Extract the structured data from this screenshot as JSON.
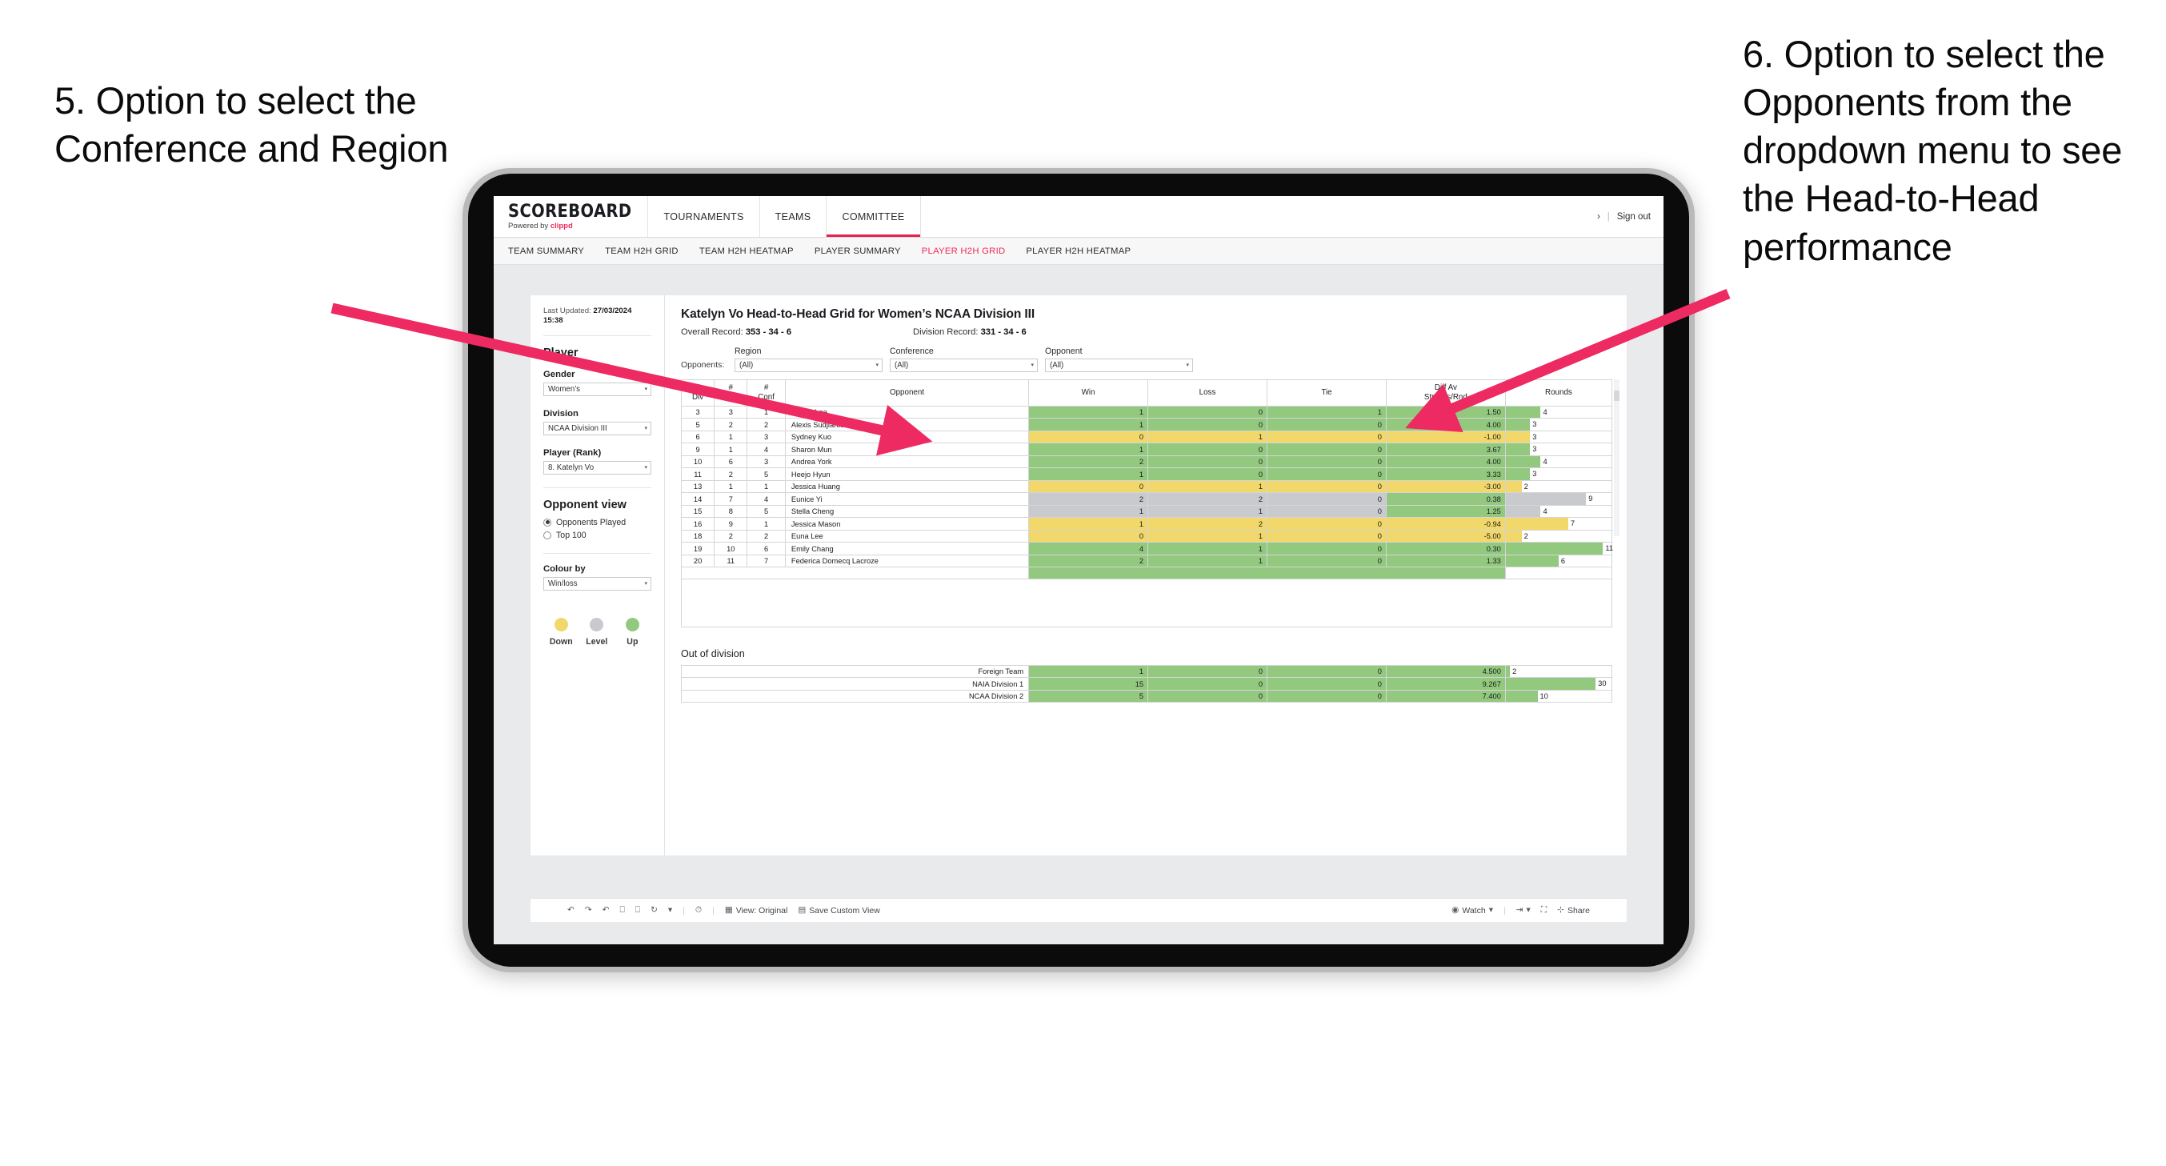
{
  "annotations": {
    "left": "5. Option to select the Conference and Region",
    "right": "6. Option to select the Opponents from the dropdown menu to see the Head-to-Head performance"
  },
  "colors": {
    "accent": "#ee2060",
    "arrow": "#ee2a62",
    "up_green": "#93c97e",
    "down_yellow": "#f2d86a",
    "level_gray": "#c9cace"
  },
  "topnav": {
    "brand_name": "SCOREBOARD",
    "brand_sub_prefix": "Powered by ",
    "brand_sub_accent": "clippd",
    "items": [
      {
        "label": "TOURNAMENTS",
        "active": false
      },
      {
        "label": "TEAMS",
        "active": false
      },
      {
        "label": "COMMITTEE",
        "active": true
      }
    ],
    "chevron": "›",
    "divider": "|",
    "signout": "Sign out"
  },
  "subnav": {
    "items": [
      {
        "label": "TEAM SUMMARY",
        "active": false
      },
      {
        "label": "TEAM H2H GRID",
        "active": false
      },
      {
        "label": "TEAM H2H HEATMAP",
        "active": false
      },
      {
        "label": "PLAYER SUMMARY",
        "active": false
      },
      {
        "label": "PLAYER H2H GRID",
        "active": true
      },
      {
        "label": "PLAYER H2H HEATMAP",
        "active": false
      }
    ]
  },
  "sidebar": {
    "last_updated_label": "Last Updated: ",
    "last_updated_value": "27/03/2024 15:38",
    "player_heading": "Player",
    "gender": {
      "label": "Gender",
      "value": "Women’s"
    },
    "division": {
      "label": "Division",
      "value": "NCAA Division III"
    },
    "player_rank": {
      "label": "Player (Rank)",
      "value": "8. Katelyn Vo"
    },
    "opponent_view": {
      "heading": "Opponent view",
      "options": [
        {
          "label": "Opponents Played",
          "selected": true
        },
        {
          "label": "Top 100",
          "selected": false
        }
      ]
    },
    "colour_by": {
      "label": "Colour by",
      "value": "Win/loss"
    },
    "legend": [
      {
        "label": "Down",
        "color": "#f2d86a"
      },
      {
        "label": "Level",
        "color": "#c9cace"
      },
      {
        "label": "Up",
        "color": "#93c97e"
      }
    ]
  },
  "main": {
    "title": "Katelyn Vo Head-to-Head Grid for Women’s NCAA Division III",
    "overall_record_label": "Overall Record: ",
    "overall_record_value": "353 - 34 - 6",
    "division_record_label": "Division Record: ",
    "division_record_value": "331 - 34 - 6",
    "opponents_label": "Opponents:",
    "filters": [
      {
        "label": "Region",
        "value": "(All)"
      },
      {
        "label": "Conference",
        "value": "(All)"
      },
      {
        "label": "Opponent",
        "value": "(All)"
      }
    ]
  },
  "chart_data": {
    "type": "table",
    "title": "Katelyn Vo Head-to-Head Grid for Women’s NCAA Division III",
    "columns": [
      "# Div",
      "# Reg",
      "# Conf",
      "Opponent",
      "Win",
      "Loss",
      "Tie",
      "Diff Av Strokes/Rnd",
      "Rounds"
    ],
    "column_headers_two_line": [
      [
        "#",
        "Div"
      ],
      [
        "#",
        "Reg"
      ],
      [
        "#",
        "Conf"
      ],
      [
        "Opponent",
        ""
      ],
      [
        "Win",
        ""
      ],
      [
        "Loss",
        ""
      ],
      [
        "Tie",
        ""
      ],
      [
        "Diff Av",
        "Strokes/Rnd"
      ],
      [
        "Rounds",
        ""
      ]
    ],
    "rows": [
      {
        "div": "3",
        "reg": "3",
        "conf": "1",
        "opponent": "Esther Lee",
        "win": "1",
        "loss": "0",
        "tie": "1",
        "diff": "1.50",
        "rounds": "4",
        "rounds_pct": 33,
        "state": "up"
      },
      {
        "div": "5",
        "reg": "2",
        "conf": "2",
        "opponent": "Alexis Sudjianto",
        "win": "1",
        "loss": "0",
        "tie": "0",
        "diff": "4.00",
        "rounds": "3",
        "rounds_pct": 23,
        "state": "up"
      },
      {
        "div": "6",
        "reg": "1",
        "conf": "3",
        "opponent": "Sydney Kuo",
        "win": "0",
        "loss": "1",
        "tie": "0",
        "diff": "-1.00",
        "rounds": "3",
        "rounds_pct": 23,
        "state": "down"
      },
      {
        "div": "9",
        "reg": "1",
        "conf": "4",
        "opponent": "Sharon Mun",
        "win": "1",
        "loss": "0",
        "tie": "0",
        "diff": "3.67",
        "rounds": "3",
        "rounds_pct": 23,
        "state": "up"
      },
      {
        "div": "10",
        "reg": "6",
        "conf": "3",
        "opponent": "Andrea York",
        "win": "2",
        "loss": "0",
        "tie": "0",
        "diff": "4.00",
        "rounds": "4",
        "rounds_pct": 33,
        "state": "up"
      },
      {
        "div": "11",
        "reg": "2",
        "conf": "5",
        "opponent": "Heejo Hyun",
        "win": "1",
        "loss": "0",
        "tie": "0",
        "diff": "3.33",
        "rounds": "3",
        "rounds_pct": 23,
        "state": "up"
      },
      {
        "div": "13",
        "reg": "1",
        "conf": "1",
        "opponent": "Jessica Huang",
        "win": "0",
        "loss": "1",
        "tie": "0",
        "diff": "-3.00",
        "rounds": "2",
        "rounds_pct": 15,
        "state": "down"
      },
      {
        "div": "14",
        "reg": "7",
        "conf": "4",
        "opponent": "Eunice Yi",
        "win": "2",
        "loss": "2",
        "tie": "0",
        "diff": "0.38",
        "rounds": "9",
        "rounds_pct": 76,
        "state": "level",
        "diff_state": "up"
      },
      {
        "div": "15",
        "reg": "8",
        "conf": "5",
        "opponent": "Stella Cheng",
        "win": "1",
        "loss": "1",
        "tie": "0",
        "diff": "1.25",
        "rounds": "4",
        "rounds_pct": 33,
        "state": "level",
        "diff_state": "up"
      },
      {
        "div": "16",
        "reg": "9",
        "conf": "1",
        "opponent": "Jessica Mason",
        "win": "1",
        "loss": "2",
        "tie": "0",
        "diff": "-0.94",
        "rounds": "7",
        "rounds_pct": 59,
        "state": "down"
      },
      {
        "div": "18",
        "reg": "2",
        "conf": "2",
        "opponent": "Euna Lee",
        "win": "0",
        "loss": "1",
        "tie": "0",
        "diff": "-5.00",
        "rounds": "2",
        "rounds_pct": 15,
        "state": "down"
      },
      {
        "div": "19",
        "reg": "10",
        "conf": "6",
        "opponent": "Emily Chang",
        "win": "4",
        "loss": "1",
        "tie": "0",
        "diff": "0.30",
        "rounds": "11",
        "rounds_pct": 92,
        "state": "up"
      },
      {
        "div": "20",
        "reg": "11",
        "conf": "7",
        "opponent": "Federica Domecq Lacroze",
        "win": "2",
        "loss": "1",
        "tie": "0",
        "diff": "1.33",
        "rounds": "6",
        "rounds_pct": 50,
        "state": "up"
      }
    ],
    "out_of_division": {
      "title": "Out of division",
      "rows": [
        {
          "label": "Foreign Team",
          "win": "1",
          "loss": "0",
          "tie": "0",
          "diff": "4.500",
          "rounds": "2",
          "rounds_pct": 4,
          "state": "up"
        },
        {
          "label": "NAIA Division 1",
          "win": "15",
          "loss": "0",
          "tie": "0",
          "diff": "9.267",
          "rounds": "30",
          "rounds_pct": 85,
          "state": "up"
        },
        {
          "label": "NCAA Division 2",
          "win": "5",
          "loss": "0",
          "tie": "0",
          "diff": "7.400",
          "rounds": "10",
          "rounds_pct": 30,
          "state": "up"
        }
      ]
    }
  },
  "toolbar": {
    "undo": "undo-icon",
    "redo": "redo-icon",
    "revert": "revert-icon",
    "refresh": "refresh-icon",
    "pause": "pause-icon",
    "dashboard_loop": "loop-icon",
    "loop_caret": "▾",
    "history": "history-icon",
    "view_icon": "view-icon",
    "view_label": "View: Original",
    "save_icon": "save-view-icon",
    "save_label": "Save Custom View",
    "watch_icon": "watch-icon",
    "watch_label": "Watch",
    "watch_caret": "▾",
    "download_icon": "download-icon",
    "download_caret": "▾",
    "fullscreen_icon": "fullscreen-icon",
    "share_icon": "share-icon",
    "share_label": "Share",
    "sep": "|"
  }
}
